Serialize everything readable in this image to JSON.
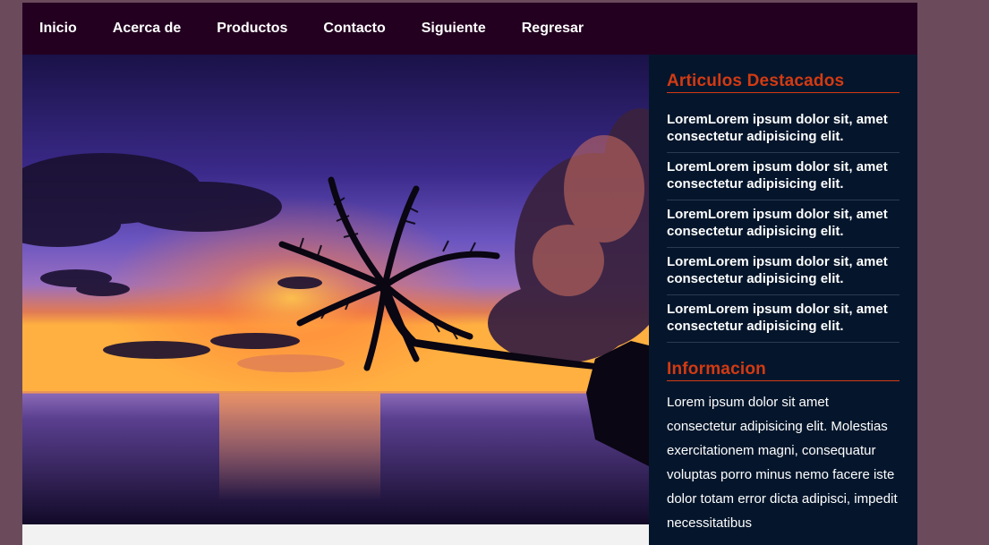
{
  "nav": {
    "items": [
      {
        "label": "Inicio",
        "name": "nav-inicio"
      },
      {
        "label": "Acerca de",
        "name": "nav-acerca-de"
      },
      {
        "label": "Productos",
        "name": "nav-productos"
      },
      {
        "label": "Contacto",
        "name": "nav-contacto"
      },
      {
        "label": "Siguiente",
        "name": "nav-siguiente"
      },
      {
        "label": "Regresar",
        "name": "nav-regresar"
      }
    ]
  },
  "sidebar": {
    "featured_title": "Articulos Destacados",
    "featured_items": [
      "LoremLorem ipsum dolor sit, amet consectetur adipisicing elit.",
      "LoremLorem ipsum dolor sit, amet consectetur adipisicing elit.",
      "LoremLorem ipsum dolor sit, amet consectetur adipisicing elit.",
      "LoremLorem ipsum dolor sit, amet consectetur adipisicing elit.",
      "LoremLorem ipsum dolor sit, amet consectetur adipisicing elit."
    ],
    "info_title": "Informacion",
    "info_text": "Lorem ipsum dolor sit amet consectetur adipisicing elit. Molestias exercitationem magni, consequatur voluptas porro minus nemo facere iste dolor totam error dicta adipisci, impedit necessitatibus"
  },
  "colors": {
    "page_bg": "#6b4a5c",
    "nav_bg": "#230020",
    "sidebar_bg": "#05162c",
    "accent": "#d33a12"
  }
}
